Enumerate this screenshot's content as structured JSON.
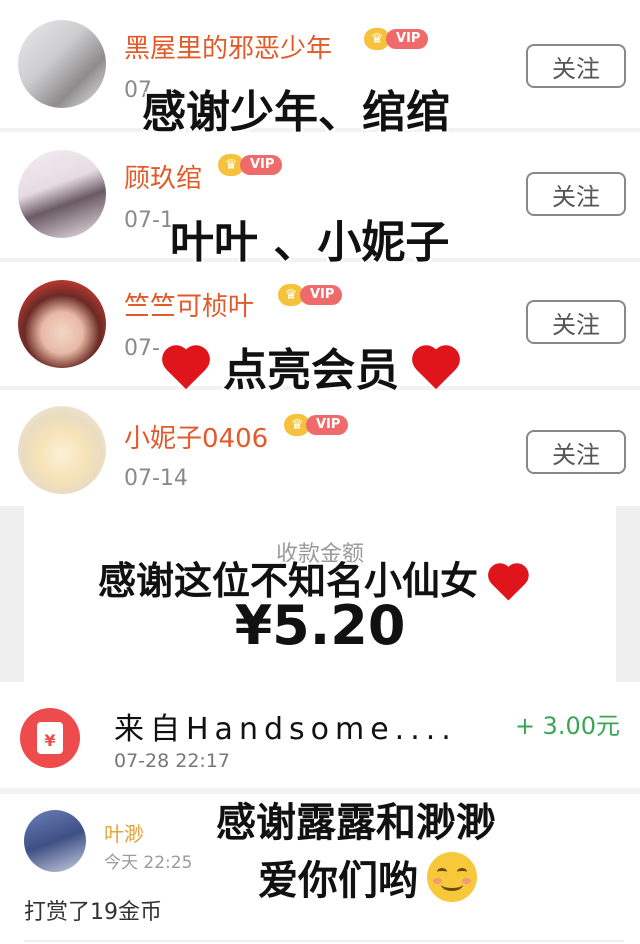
{
  "followers": [
    {
      "name": "黑屋里的邪恶少年",
      "vip": "VIP",
      "date": "07",
      "follow": "关注"
    },
    {
      "name": "顾玖绾",
      "vip": "VIP",
      "date": "07-1",
      "follow": "关注"
    },
    {
      "name": "竺竺可桢叶",
      "vip": "VIP",
      "date": "07-",
      "follow": "关注"
    },
    {
      "name": "小妮子0406",
      "vip": "VIP",
      "date": "07-14",
      "follow": "关注"
    }
  ],
  "payment": {
    "label": "收款金额",
    "amount": "¥5.20"
  },
  "transaction": {
    "from": "来自Handsome....",
    "amount": "+ 3.00元",
    "time": "07-28 22:17"
  },
  "tip": {
    "name": "叶渺",
    "time": "今天 22:25",
    "text": "打赏了19金币"
  },
  "overlays": {
    "l1": "感谢少年、绾绾",
    "l2": "叶叶 、小妮子",
    "l3": "点亮会员",
    "l4": "感谢这位不知名小仙女",
    "l5": "感谢露露和渺渺",
    "l6": "爱你们哟"
  },
  "colors": {
    "name": "#e35a2a",
    "vip": "#ef6b6b",
    "green": "#3aa655",
    "red_packet": "#ee4c4c"
  }
}
